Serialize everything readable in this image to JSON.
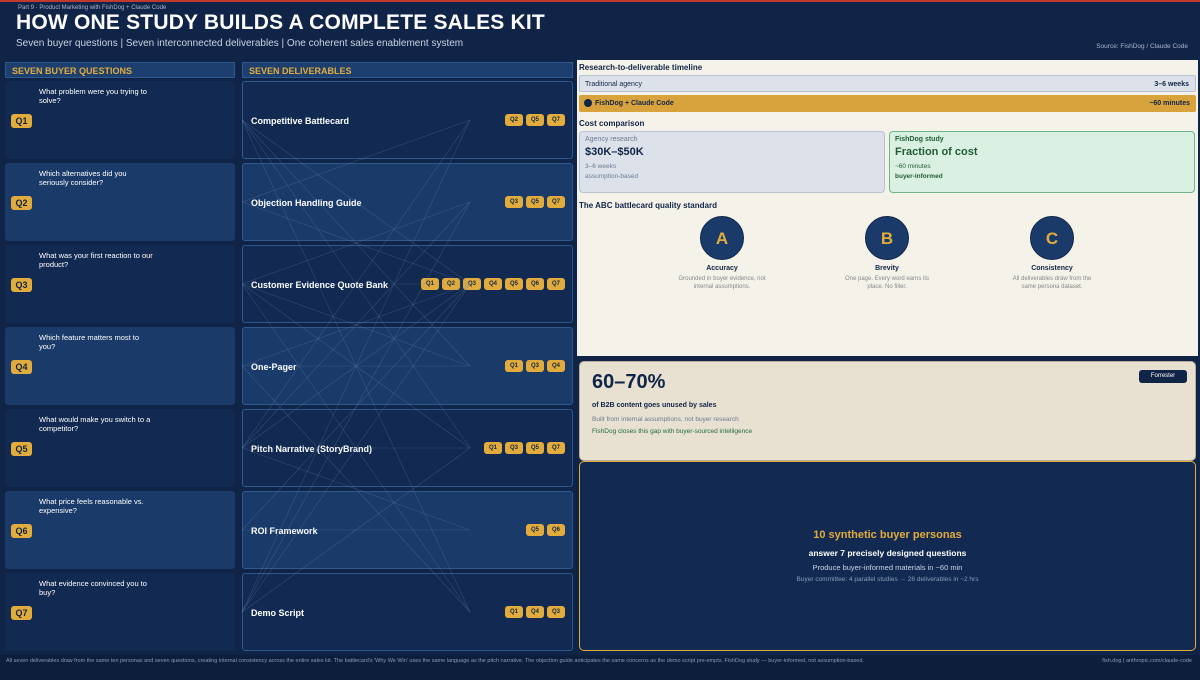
{
  "header": {
    "breadcrumb": "Part 9 · Product Marketing with FishDog + Claude Code",
    "title": "HOW ONE STUDY BUILDS A COMPLETE SALES KIT",
    "subtitle": "Seven buyer questions  |  Seven interconnected deliverables  |  One coherent sales enablement system",
    "source": "Source: FishDog / Claude Code"
  },
  "questions_heading": "SEVEN BUYER QUESTIONS",
  "deliverables_heading": "SEVEN DELIVERABLES",
  "questions": [
    {
      "id": "Q1",
      "text": "What problem were you trying to solve?"
    },
    {
      "id": "Q2",
      "text": "Which alternatives did you seriously consider?"
    },
    {
      "id": "Q3",
      "text": "What was your first reaction to our product?"
    },
    {
      "id": "Q4",
      "text": "Which feature matters most to you?"
    },
    {
      "id": "Q5",
      "text": "What would make you switch to a competitor?"
    },
    {
      "id": "Q6",
      "text": "What price feels reasonable vs. expensive?"
    },
    {
      "id": "Q7",
      "text": "What evidence convinced you to buy?"
    }
  ],
  "deliverables": [
    {
      "name": "Competitive Battlecard",
      "questions": [
        "Q2",
        "Q5",
        "Q7"
      ]
    },
    {
      "name": "Objection Handling Guide",
      "questions": [
        "Q3",
        "Q5",
        "Q7"
      ]
    },
    {
      "name": "Customer Evidence Quote Bank",
      "questions": [
        "Q1",
        "Q2",
        "Q3",
        "Q4",
        "Q5",
        "Q6",
        "Q7"
      ]
    },
    {
      "name": "One-Pager",
      "questions": [
        "Q1",
        "Q3",
        "Q4"
      ]
    },
    {
      "name": "Pitch Narrative (StoryBrand)",
      "questions": [
        "Q1",
        "Q3",
        "Q5",
        "Q7"
      ]
    },
    {
      "name": "ROI Framework",
      "questions": [
        "Q5",
        "Q6"
      ]
    },
    {
      "name": "Demo Script",
      "questions": [
        "Q1",
        "Q4",
        "Q3"
      ]
    }
  ],
  "timeline": {
    "heading": "Research-to-deliverable timeline",
    "traditional_label": "Traditional agency",
    "traditional_value": "3–6 weeks",
    "study_label": "FishDog + Claude Code",
    "study_value": "~60 minutes"
  },
  "cost": {
    "heading": "Cost comparison",
    "agency": {
      "label": "Agency research",
      "value": "$30K–$50K",
      "time": "3–6 weeks",
      "basis": "assumption-based"
    },
    "study": {
      "label": "FishDog study",
      "value": "Fraction of cost",
      "time": "~60 minutes",
      "basis": "buyer-informed"
    }
  },
  "abc": {
    "heading": "The ABC battlecard quality standard",
    "items": [
      {
        "letter": "A",
        "title": "Accuracy",
        "desc": "Grounded in buyer evidence, not internal assumptions."
      },
      {
        "letter": "B",
        "title": "Brevity",
        "desc": "One page. Every word earns its place. No filler."
      },
      {
        "letter": "C",
        "title": "Consistency",
        "desc": "All deliverables draw from the same persona dataset."
      }
    ]
  },
  "stat": {
    "value": "60–70%",
    "caption": "of B2B content goes unused by sales",
    "note": "Built from internal assumptions, not buyer research",
    "highlight": "FishDog closes this gap with buyer-sourced intelligence",
    "source_badge": "Forrester"
  },
  "summary": {
    "line1": "10 synthetic buyer personas",
    "line2": "answer 7 precisely designed questions",
    "line3": "Produce buyer-informed materials in ~60 min",
    "line4": "Buyer committee: 4 parallel studies → 28 deliverables in ~2 hrs"
  },
  "footer": {
    "note": "All seven deliverables draw from the same ten personas and seven questions, creating internal consistency across the entire sales kit. The battlecard's 'Why We Win' uses the same language as the pitch narrative. The objection guide anticipates the same concerns as the demo script pre-empts. FishDog study — buyer-informed, not assumption-based.",
    "links": "fish.dog  |  anthropic.com/claude-code"
  },
  "colors": {
    "navy": "#102447",
    "gold": "#e2ac3c",
    "card_dark": "#122a52",
    "card_light": "#1a3b6a",
    "cream": "#f5f2ea",
    "green": "#1f5c36"
  }
}
